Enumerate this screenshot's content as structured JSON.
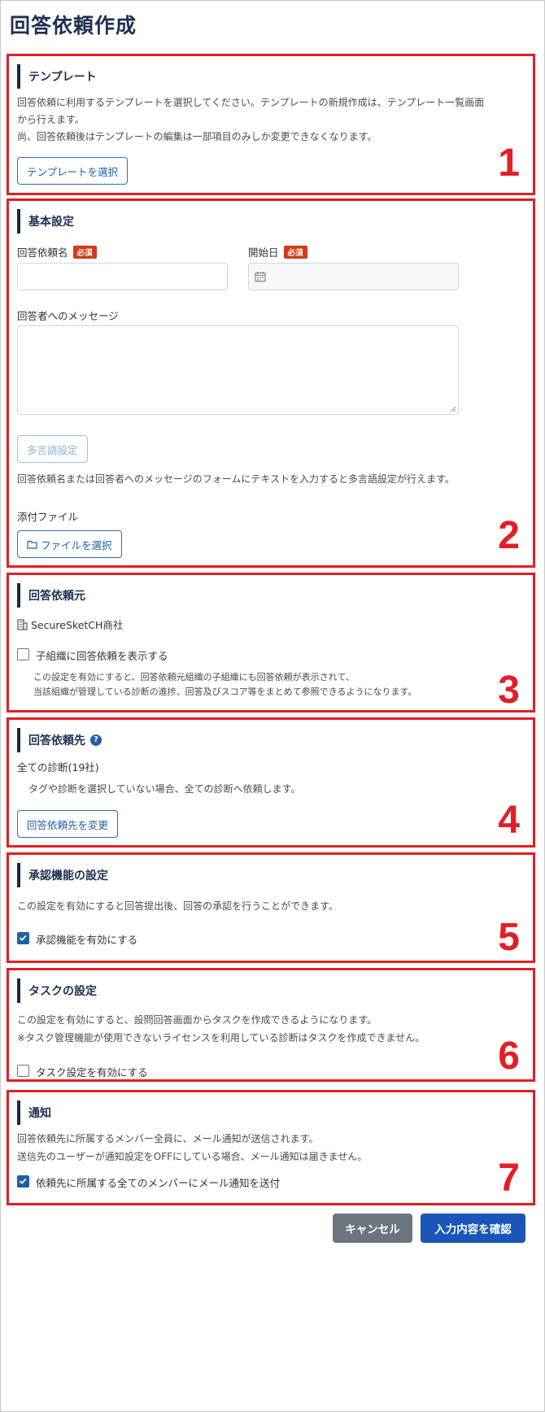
{
  "page": {
    "title": "回答依頼作成"
  },
  "template": {
    "title": "テンプレート",
    "desc1": "回答依頼に利用するテンプレートを選択してください。テンプレートの新規作成は、テンプレート一覧画面",
    "desc2": "から行えます。",
    "desc3": "尚、回答依頼後はテンプレートの編集は一部項目のみしか変更できなくなります。",
    "button": "テンプレートを選択",
    "number": "1"
  },
  "basic": {
    "title": "基本設定",
    "name_label": "回答依頼名",
    "start_label": "開始日",
    "required": "必須",
    "message_label": "回答者へのメッセージ",
    "multilang_button": "多言語設定",
    "multilang_note": "回答依頼名または回答者へのメッセージのフォームにテキストを入力すると多言語設定が行えます。",
    "attach_label": "添付ファイル",
    "file_button": "ファイルを選択",
    "number": "2"
  },
  "source": {
    "title": "回答依頼元",
    "company": "SecureSketCH商社",
    "checkbox_label": "子組織に回答依頼を表示する",
    "checked": false,
    "note1": "この設定を有効にすると、回答依頼元組織の子組織にも回答依頼が表示されて、",
    "note2": "当該組織が管理している診断の進捗、回答及びスコア等をまとめて参照できるようになります。",
    "number": "3"
  },
  "destination": {
    "title": "回答依頼先",
    "all_label": "全ての診断(19社)",
    "note": "タグや診断を選択していない場合、全ての診断へ依頼します。",
    "button": "回答依頼先を変更",
    "number": "4"
  },
  "approval": {
    "title": "承認機能の設定",
    "desc": "この設定を有効にすると回答提出後、回答の承認を行うことができます。",
    "checkbox_label": "承認機能を有効にする",
    "checked": true,
    "number": "5"
  },
  "task": {
    "title": "タスクの設定",
    "desc1": "この設定を有効にすると、設問回答画面からタスクを作成できるようになります。",
    "desc2": "※タスク管理機能が使用できないライセンスを利用している診断はタスクを作成できません。",
    "checkbox_label": "タスク設定を有効にする",
    "checked": false,
    "number": "6"
  },
  "notify": {
    "title": "通知",
    "desc1": "回答依頼先に所属するメンバー全員に、メール通知が送信されます。",
    "desc2": "送信先のユーザーが通知設定をOFFにしている場合、メール通知は届きません。",
    "checkbox_label": "依頼先に所属する全てのメンバーにメール通知を送付",
    "checked": true,
    "number": "7"
  },
  "footer": {
    "cancel": "キャンセル",
    "confirm": "入力内容を確認"
  },
  "colors": {
    "accent": "#1f5fa8",
    "highlight": "#e31e24",
    "required": "#d13b16",
    "cancel": "#6c757d",
    "confirm": "#1a56b8"
  }
}
